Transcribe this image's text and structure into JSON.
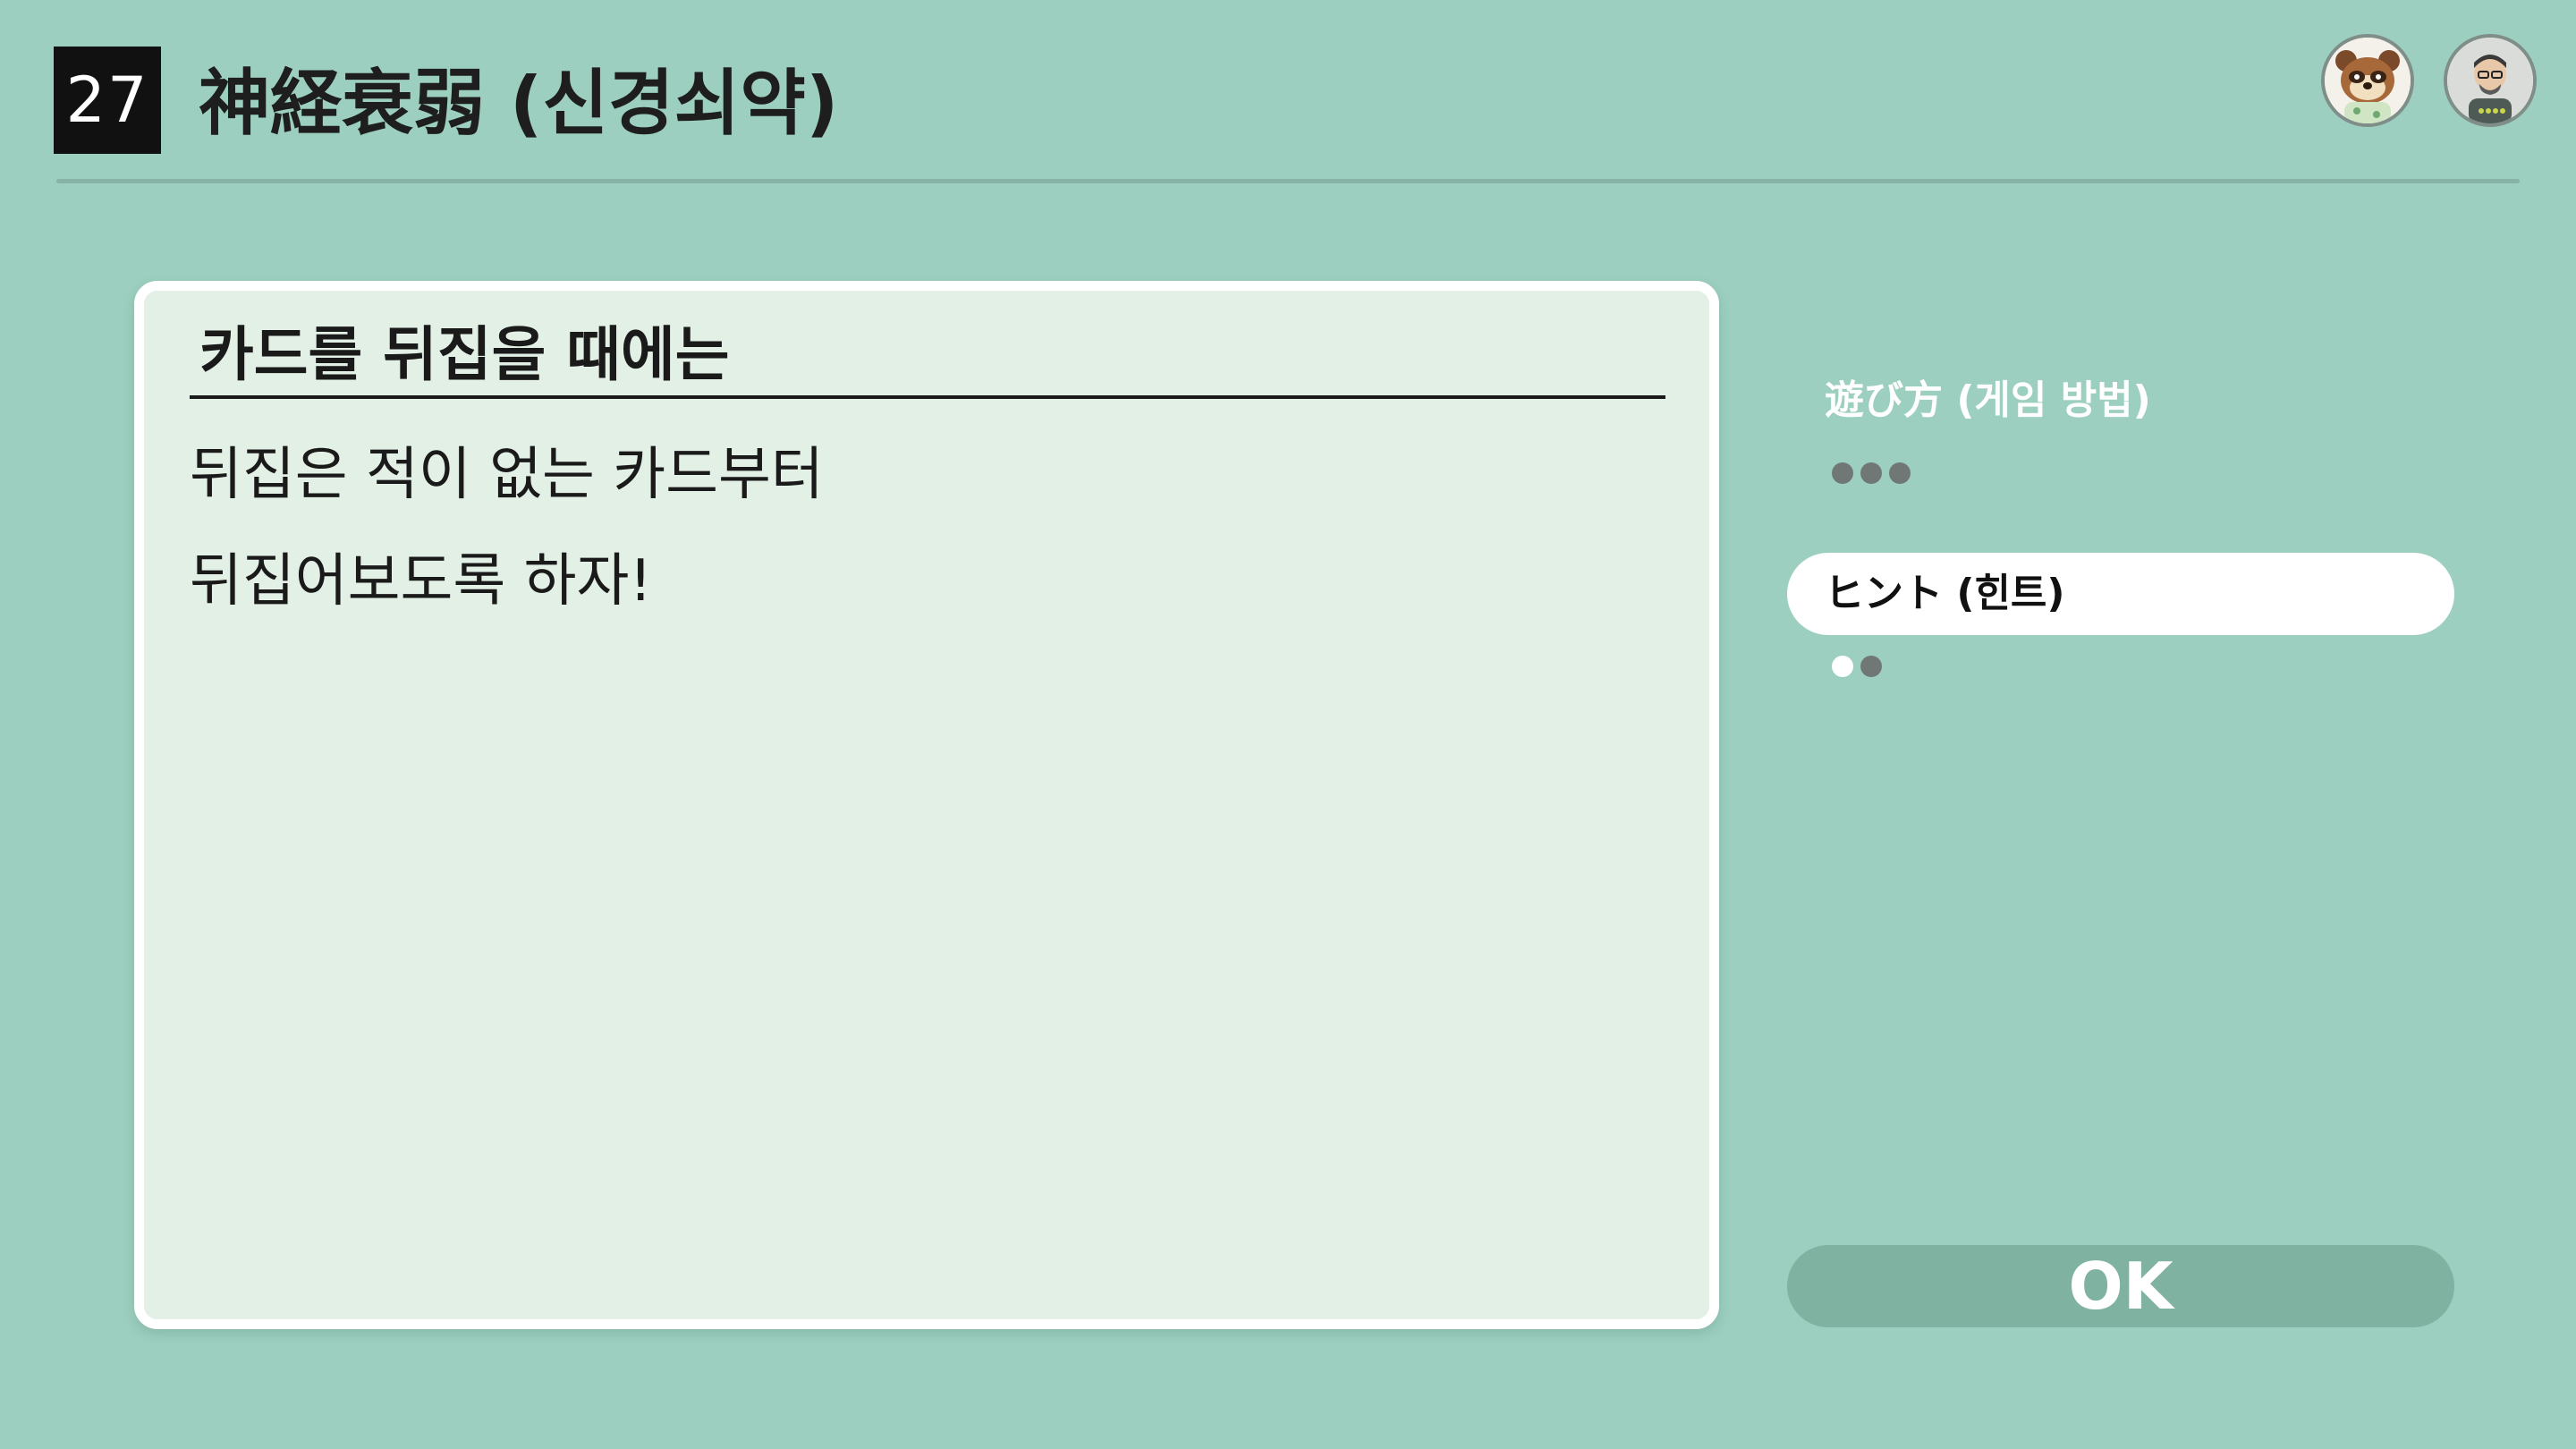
{
  "header": {
    "number": "27",
    "title": "神経衰弱 (신경쇠약)"
  },
  "avatars": [
    {
      "name": "tanuki-character"
    },
    {
      "name": "player-mii"
    }
  ],
  "panel": {
    "title": "카드를 뒤집을 때에는",
    "lines": [
      "뒤집은 적이 없는 카드부터",
      "뒤집어보도록 하자!"
    ]
  },
  "side_menu": {
    "items": [
      {
        "label": "遊び方 (게임 방법)",
        "pages": 3,
        "current_page": 0,
        "selected": false
      },
      {
        "label": "ヒント (힌트)",
        "pages": 2,
        "current_page": 1,
        "selected": true
      }
    ]
  },
  "ok_button": {
    "label": "OK"
  },
  "colors": {
    "background": "#9ccfbf",
    "panel": "#e3f0e6",
    "button": "#80b2a2",
    "selected_item": "#ffffff",
    "inactive_dot": "#707875"
  }
}
